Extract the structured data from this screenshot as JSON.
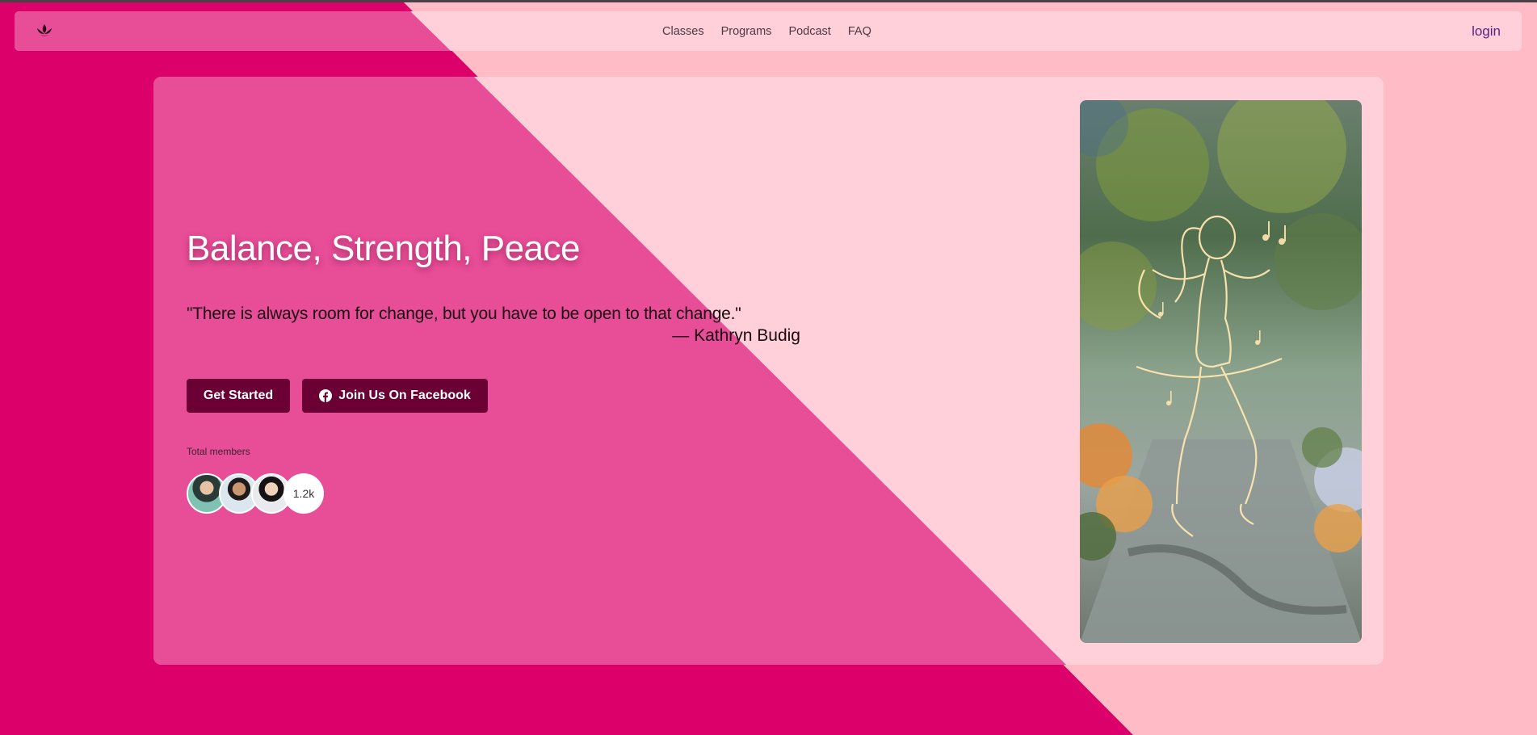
{
  "nav": {
    "logo_icon": "lotus-icon",
    "links": [
      "Classes",
      "Programs",
      "Podcast",
      "FAQ"
    ],
    "login_label": "login"
  },
  "hero": {
    "title": "Balance, Strength, Peace",
    "quote": "\"There is always room for change, but you have to be open to that change.\"",
    "author": "— Kathryn Budig",
    "primary_button": "Get Started",
    "facebook_button": "Join Us On Facebook",
    "facebook_icon": "facebook-icon",
    "members_label": "Total members",
    "members_count": "1.2k",
    "image_icon": "dancing-woman-illustration"
  },
  "colors": {
    "primary_pink": "#dc006a",
    "light_pink": "#ffd0d9",
    "button": "#6a0033",
    "login": "#5a2382"
  }
}
